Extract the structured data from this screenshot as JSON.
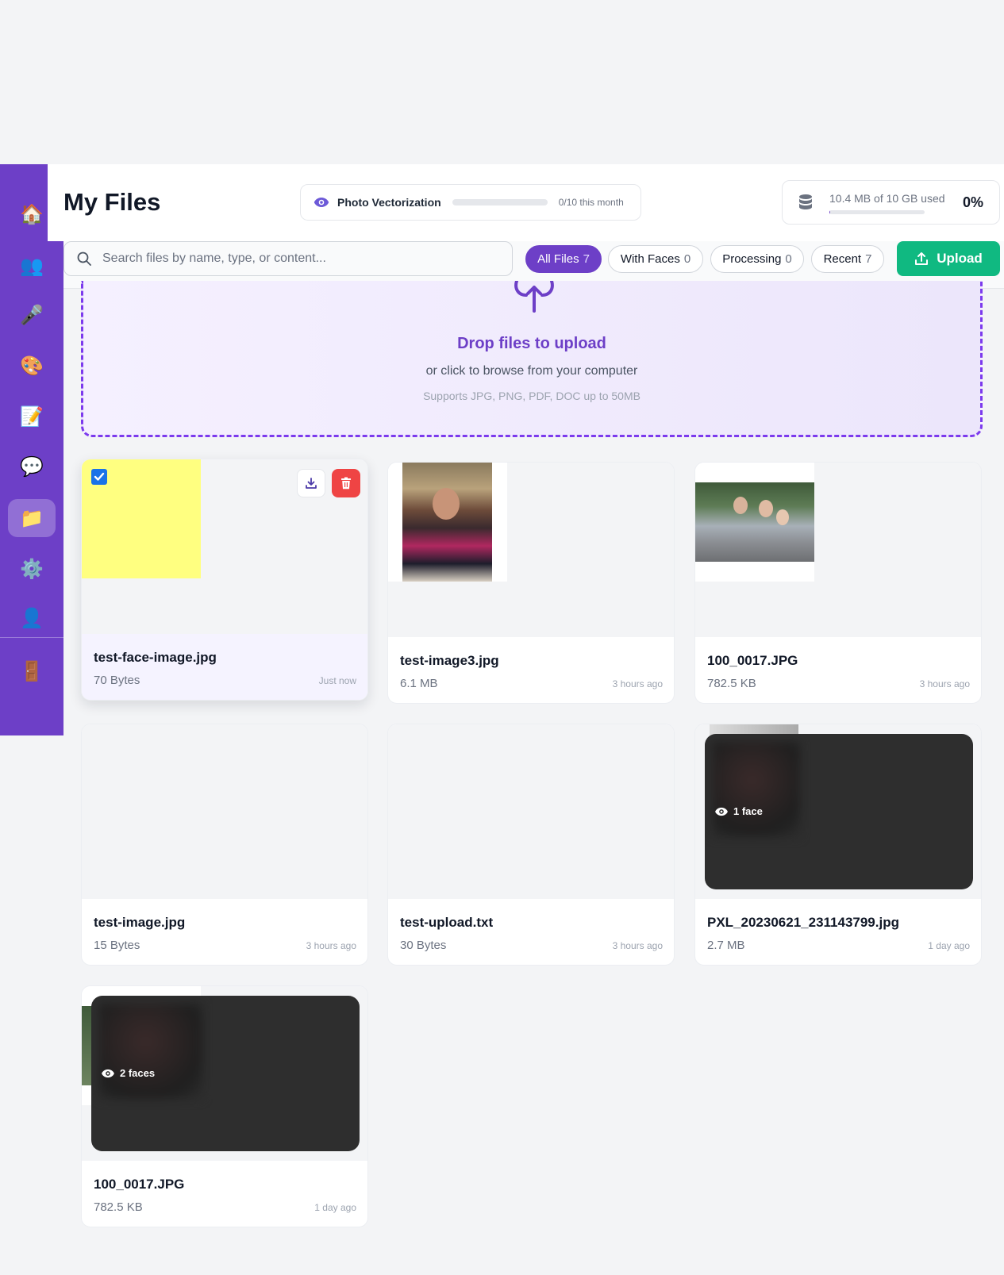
{
  "sidebar": {
    "items": [
      {
        "name": "home",
        "icon": "🏠"
      },
      {
        "name": "users",
        "icon": "👥"
      },
      {
        "name": "microphone",
        "icon": "🎤"
      },
      {
        "name": "palette",
        "icon": "🎨"
      },
      {
        "name": "notes",
        "icon": "📝"
      },
      {
        "name": "chat",
        "icon": "💬"
      },
      {
        "name": "files",
        "icon": "📁"
      },
      {
        "name": "settings",
        "icon": "⚙️"
      },
      {
        "name": "profile",
        "icon": "👤"
      },
      {
        "name": "logout",
        "icon": "🚪"
      }
    ],
    "accent": "#6d3fc7"
  },
  "header": {
    "title": "My Files",
    "quota": {
      "label": "Photo Vectorization",
      "count": "0/10 this month",
      "fraction": 0
    },
    "storage": {
      "text": "10.4 MB of 10 GB used",
      "percent": "0%",
      "fraction": 0.001
    }
  },
  "toolbar": {
    "search_placeholder": "Search files by name, type, or content...",
    "filters": [
      {
        "label": "All Files",
        "count": "7",
        "active": true
      },
      {
        "label": "With Faces",
        "count": "0",
        "active": false
      },
      {
        "label": "Processing",
        "count": "0",
        "active": false
      },
      {
        "label": "Recent",
        "count": "7",
        "active": false
      }
    ],
    "upload_label": "Upload"
  },
  "dropzone": {
    "title": "Drop files to upload",
    "subtitle": "or click to browse from your computer",
    "note": "Supports JPG, PNG, PDF, DOC up to 50MB"
  },
  "files": [
    {
      "name": "test-face-image.jpg",
      "size": "70 Bytes",
      "time": "Just now",
      "selected": true
    },
    {
      "name": "test-image3.jpg",
      "size": "6.1 MB",
      "time": "3 hours ago"
    },
    {
      "name": "100_0017.JPG",
      "size": "782.5 KB",
      "time": "3 hours ago"
    },
    {
      "name": "test-image.jpg",
      "size": "15 Bytes",
      "time": "3 hours ago"
    },
    {
      "name": "test-upload.txt",
      "size": "30 Bytes",
      "time": "3 hours ago"
    },
    {
      "name": "PXL_20230621_231143799.jpg",
      "size": "2.7 MB",
      "time": "1 day ago",
      "faces": "1 face"
    },
    {
      "name": "100_0017.JPG",
      "size": "782.5 KB",
      "time": "1 day ago",
      "faces": "2 faces"
    }
  ],
  "colors": {
    "accent": "#6d3fc7",
    "success": "#10b981",
    "danger": "#ef4444"
  }
}
